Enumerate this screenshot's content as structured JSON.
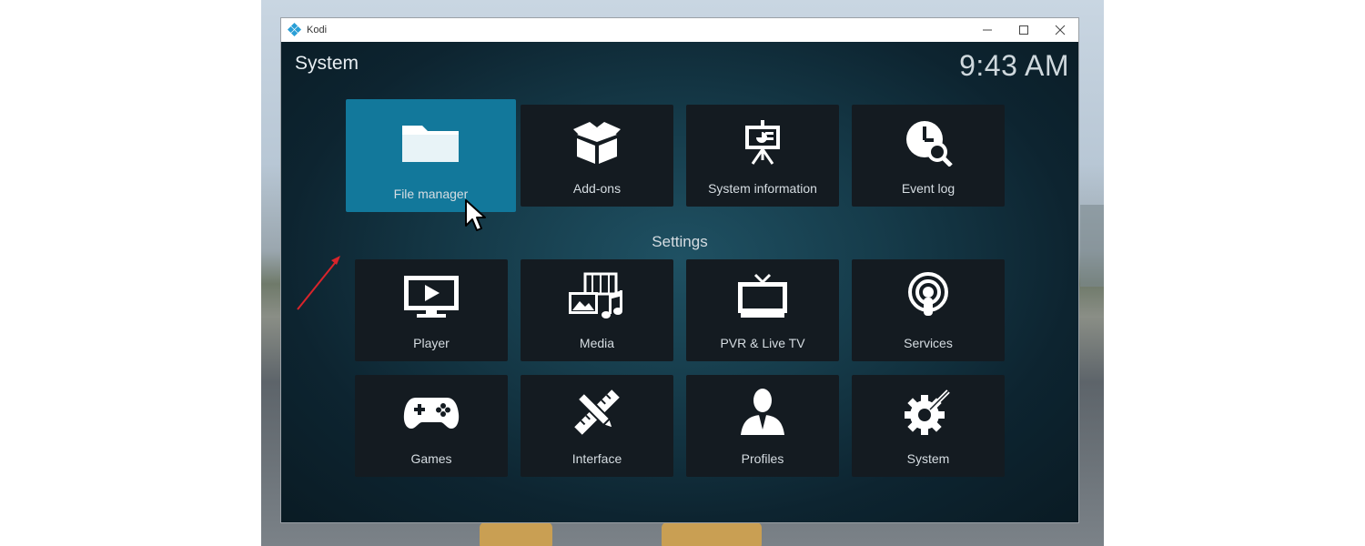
{
  "window": {
    "app_title": "Kodi",
    "controls": [
      "minimize",
      "maximize",
      "close"
    ]
  },
  "header": {
    "title": "System",
    "clock": "9:43 AM"
  },
  "top_row": [
    {
      "label": "File manager",
      "icon": "folder-icon",
      "focused": true
    },
    {
      "label": "Add-ons",
      "icon": "open-box-icon",
      "focused": false
    },
    {
      "label": "System information",
      "icon": "presentation-board-icon",
      "focused": false
    },
    {
      "label": "Event log",
      "icon": "clock-search-icon",
      "focused": false
    }
  ],
  "settings_section": {
    "label": "Settings",
    "items": [
      {
        "label": "Player",
        "icon": "monitor-play-icon"
      },
      {
        "label": "Media",
        "icon": "media-collage-icon"
      },
      {
        "label": "PVR & Live TV",
        "icon": "tv-icon"
      },
      {
        "label": "Services",
        "icon": "podcast-broadcast-icon"
      },
      {
        "label": "Games",
        "icon": "gamepad-icon"
      },
      {
        "label": "Interface",
        "icon": "pencil-ruler-icon"
      },
      {
        "label": "Profiles",
        "icon": "user-profile-icon"
      },
      {
        "label": "System",
        "icon": "gears-icon"
      }
    ]
  },
  "colors": {
    "focus_tile": "#12789b",
    "tile": "#141b21",
    "annotation_arrow": "#d9242b"
  }
}
